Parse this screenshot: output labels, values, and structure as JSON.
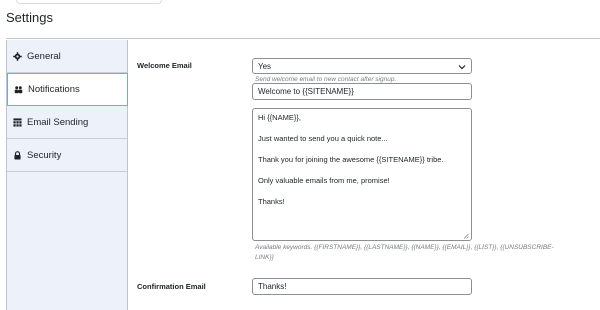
{
  "page": {
    "title": "Settings"
  },
  "sidebar": {
    "items": [
      {
        "label": "General",
        "icon": "gear-icon",
        "active": false
      },
      {
        "label": "Notifications",
        "icon": "group-icon",
        "active": true
      },
      {
        "label": "Email Sending",
        "icon": "table-icon",
        "active": false
      },
      {
        "label": "Security",
        "icon": "lock-icon",
        "active": false
      }
    ]
  },
  "welcome_email": {
    "label": "Welcome Email",
    "select_value": "Yes",
    "hint": "Send welcome email to new contact after signup.",
    "subject_value": "Welcome to {{SITENAME}}",
    "body_lines": [
      "Hi {{NAME}},",
      "Just wanted to send you a quick note...",
      "Thank you for joining the awesome {{SITENAME}} tribe.",
      "Only valuable emails from me, promise!",
      "Thanks!"
    ],
    "keywords_hint_1": "Available keywords. {{FIRSTNAME}}, {{LASTNAME}}, {{NAME}}, {{EMAIL}}, {{LIST}}, {{UNSUBSCRIBE-",
    "keywords_hint_2": "LINK}}"
  },
  "confirmation_email": {
    "label": "Confirmation Email",
    "subject_value": "Thanks!"
  },
  "colors": {
    "sidebar_bg": "#edf1f9",
    "active_border": "#7aa7d8",
    "hint_text": "#787c82"
  }
}
